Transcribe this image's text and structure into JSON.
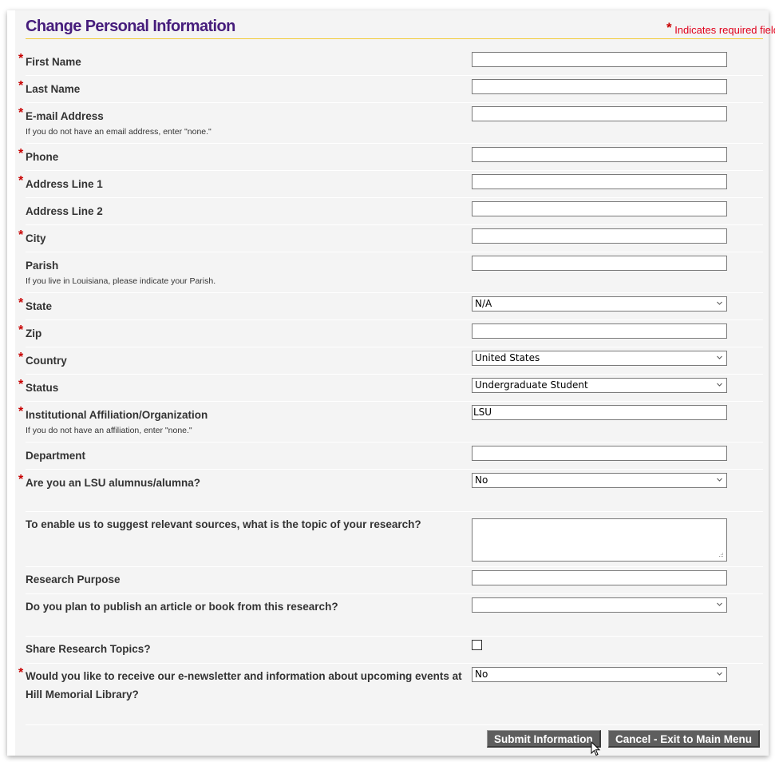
{
  "header": {
    "title": "Change Personal Information",
    "required_note": "Indicates required field",
    "required_marker": "*"
  },
  "fields": [
    {
      "label": "First Name",
      "required": true,
      "type": "text",
      "value": ""
    },
    {
      "label": "Last Name",
      "required": true,
      "type": "text",
      "value": ""
    },
    {
      "label": "E-mail Address",
      "required": true,
      "type": "text",
      "value": "",
      "hint": "If you do not have an email address, enter \"none.\""
    },
    {
      "label": "Phone",
      "required": true,
      "type": "text",
      "value": ""
    },
    {
      "label": "Address Line 1",
      "required": true,
      "type": "text",
      "value": ""
    },
    {
      "label": "Address Line 2",
      "required": false,
      "type": "text",
      "value": ""
    },
    {
      "label": "City",
      "required": true,
      "type": "text",
      "value": ""
    },
    {
      "label": "Parish",
      "required": false,
      "type": "text",
      "value": "",
      "hint": "If you live in Louisiana, please indicate your Parish."
    },
    {
      "label": "State",
      "required": true,
      "type": "select",
      "value": "N/A"
    },
    {
      "label": "Zip",
      "required": true,
      "type": "text",
      "value": ""
    },
    {
      "label": "Country",
      "required": true,
      "type": "select",
      "value": "United States"
    },
    {
      "label": "Status",
      "required": true,
      "type": "select",
      "value": "Undergraduate Student"
    },
    {
      "label": "Institutional Affiliation/Organization",
      "required": true,
      "type": "text",
      "value": "LSU",
      "hint": "If you do not have an affiliation, enter \"none.\""
    },
    {
      "label": "Department",
      "required": false,
      "type": "text",
      "value": ""
    },
    {
      "label": "Are you an LSU alumnus/alumna?",
      "required": true,
      "type": "select",
      "value": "No"
    },
    {
      "label": "To enable us to suggest relevant sources, what is the topic of your research?",
      "required": false,
      "type": "textarea",
      "value": ""
    },
    {
      "label": "Research Purpose",
      "required": false,
      "type": "text",
      "value": ""
    },
    {
      "label": "Do you plan to publish an article or book from this research?",
      "required": false,
      "type": "select",
      "value": ""
    },
    {
      "label": "Share Research Topics?",
      "required": false,
      "type": "checkbox",
      "checked": false
    },
    {
      "label": "Would you like to receive our e-newsletter and information about upcoming events at Hill Memorial Library?",
      "required": true,
      "type": "select",
      "value": "No"
    }
  ],
  "buttons": {
    "submit": "Submit Information",
    "cancel": "Cancel - Exit to Main Menu"
  },
  "colors": {
    "title": "#461d7c",
    "accent_rule": "#f2cb3c",
    "required": "#c80000",
    "button_bg": "#5e5e5e"
  }
}
